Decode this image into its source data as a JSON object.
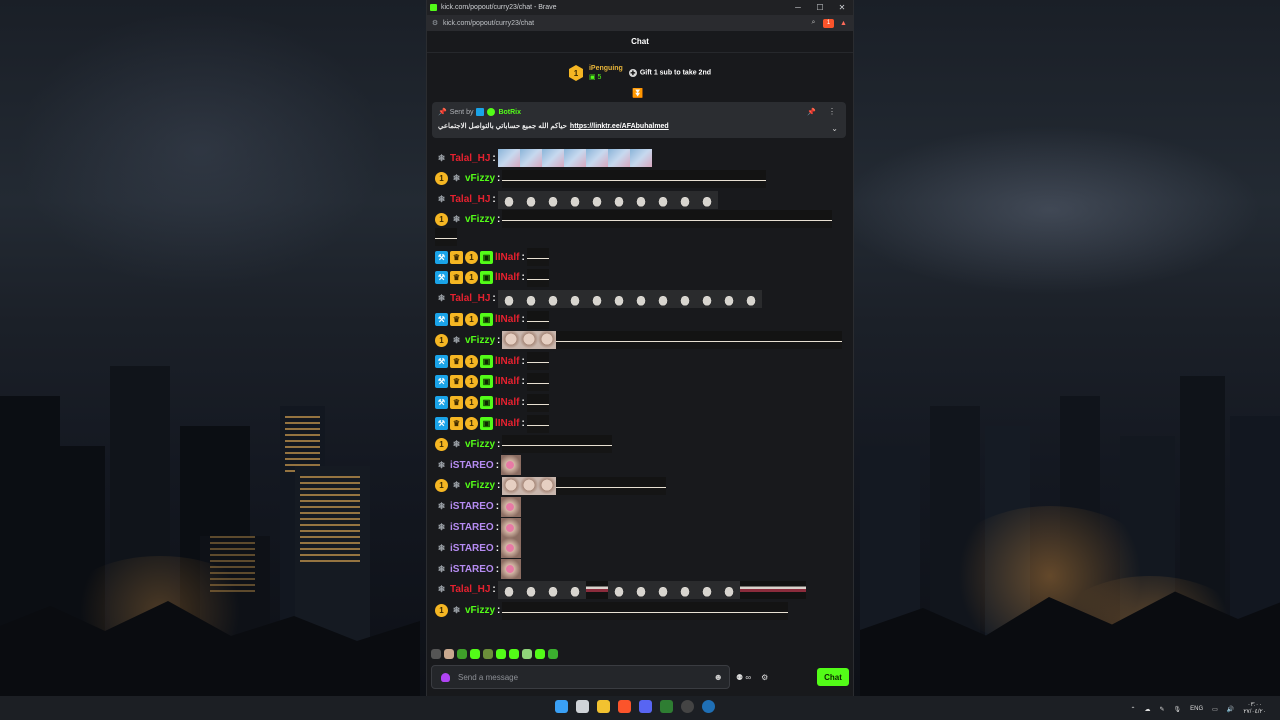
{
  "window": {
    "title": "kick.com/popout/curry23/chat - Brave",
    "url": "kick.com/popout/curry23/chat",
    "brave_badge": "1"
  },
  "chat": {
    "header": "Chat",
    "leaderboard": {
      "rank": "1",
      "user": "iPenguing",
      "count": "5",
      "gift_text": "Gift 1 sub to take 2nd"
    },
    "pinned": {
      "sent_by_label": "Sent by",
      "bot_name": "BotRix",
      "text": "حياكم الله جميع حساباتي بالتواصل الاجتماعي",
      "link": "https://linktr.ee/AFAbuhalmed"
    },
    "messages": [
      {
        "user": "Talal_HJ",
        "color": "#e6212f",
        "badges": [
          "snow"
        ],
        "emotes": [
          "blue",
          "blue",
          "blue",
          "blue",
          "blue",
          "blue",
          "blue"
        ]
      },
      {
        "user": "vFizzy",
        "color": "#53fc18",
        "badges": [
          "sub",
          "snow"
        ],
        "emotes": [
          "dark",
          "dark",
          "dark",
          "dark",
          "dark",
          "dark",
          "dark",
          "dark",
          "dark",
          "dark",
          "dark",
          "dark"
        ]
      },
      {
        "user": "Talal_HJ",
        "color": "#e6212f",
        "badges": [
          "snow"
        ],
        "emotes": [
          "puff",
          "puff",
          "puff",
          "puff",
          "puff",
          "puff",
          "puff",
          "puff",
          "puff",
          "puff"
        ]
      },
      {
        "user": "vFizzy",
        "color": "#53fc18",
        "badges": [
          "sub",
          "snow"
        ],
        "emotes": [
          "dark",
          "dark",
          "dark",
          "dark",
          "dark",
          "dark",
          "dark",
          "dark",
          "dark",
          "dark",
          "dark",
          "dark",
          "dark",
          "dark",
          "dark",
          "dark"
        ]
      },
      {
        "user": "lINalf",
        "color": "#e6212f",
        "badges": [
          "mod",
          "crown",
          "sub",
          "gift"
        ],
        "emotes": [
          "dark"
        ]
      },
      {
        "user": "lINalf",
        "color": "#e6212f",
        "badges": [
          "mod",
          "crown",
          "sub",
          "gift"
        ],
        "emotes": [
          "dark"
        ]
      },
      {
        "user": "Talal_HJ",
        "color": "#e6212f",
        "badges": [
          "snow"
        ],
        "emotes": [
          "puff",
          "puff",
          "puff",
          "puff",
          "puff",
          "puff",
          "puff",
          "puff",
          "puff",
          "puff",
          "puff",
          "puff"
        ]
      },
      {
        "user": "lINalf",
        "color": "#e6212f",
        "badges": [
          "mod",
          "crown",
          "sub",
          "gift"
        ],
        "emotes": [
          "dark"
        ]
      },
      {
        "user": "vFizzy",
        "color": "#53fc18",
        "badges": [
          "sub",
          "snow"
        ],
        "emotes": [
          "face",
          "face",
          "face",
          "dark",
          "dark",
          "dark",
          "dark",
          "dark",
          "dark",
          "dark",
          "dark",
          "dark",
          "dark",
          "dark",
          "dark",
          "dark"
        ]
      },
      {
        "user": "lINalf",
        "color": "#e6212f",
        "badges": [
          "mod",
          "crown",
          "sub",
          "gift"
        ],
        "emotes": [
          "dark"
        ]
      },
      {
        "user": "lINalf",
        "color": "#e6212f",
        "badges": [
          "mod",
          "crown",
          "sub",
          "gift"
        ],
        "emotes": [
          "dark"
        ]
      },
      {
        "user": "lINalf",
        "color": "#e6212f",
        "badges": [
          "mod",
          "crown",
          "sub",
          "gift"
        ],
        "emotes": [
          "dark"
        ]
      },
      {
        "user": "lINalf",
        "color": "#e6212f",
        "badges": [
          "mod",
          "crown",
          "sub",
          "gift"
        ],
        "emotes": [
          "dark"
        ]
      },
      {
        "user": "vFizzy",
        "color": "#53fc18",
        "badges": [
          "sub",
          "snow"
        ],
        "emotes": [
          "dark",
          "dark",
          "dark",
          "dark",
          "dark"
        ]
      },
      {
        "user": "iSTAREO",
        "color": "#b68cf2",
        "badges": [
          "snow"
        ],
        "emotes": [
          "pink"
        ]
      },
      {
        "user": "vFizzy",
        "color": "#53fc18",
        "badges": [
          "sub",
          "snow"
        ],
        "emotes": [
          "face",
          "face",
          "face",
          "dark",
          "dark",
          "dark",
          "dark",
          "dark"
        ]
      },
      {
        "user": "iSTAREO",
        "color": "#b68cf2",
        "badges": [
          "snow"
        ],
        "emotes": [
          "pink"
        ]
      },
      {
        "user": "iSTAREO",
        "color": "#b68cf2",
        "badges": [
          "snow"
        ],
        "emotes": [
          "pink"
        ]
      },
      {
        "user": "iSTAREO",
        "color": "#b68cf2",
        "badges": [
          "snow"
        ],
        "emotes": [
          "pink"
        ]
      },
      {
        "user": "iSTAREO",
        "color": "#b68cf2",
        "badges": [
          "snow"
        ],
        "emotes": [
          "pink"
        ]
      },
      {
        "user": "Talal_HJ",
        "color": "#e6212f",
        "badges": [
          "snow"
        ],
        "emotes": [
          "puff",
          "puff",
          "puff",
          "puff",
          "bar",
          "puff",
          "puff",
          "puff",
          "puff",
          "puff",
          "puff",
          "bar",
          "bar",
          "bar"
        ]
      },
      {
        "user": "vFizzy",
        "color": "#53fc18",
        "badges": [
          "sub",
          "snow"
        ],
        "emotes": [
          "dark",
          "dark",
          "dark",
          "dark",
          "dark",
          "dark",
          "dark",
          "dark",
          "dark",
          "dark",
          "dark",
          "dark",
          "dark"
        ]
      }
    ],
    "input": {
      "placeholder": "Send a message",
      "infinity": "∞",
      "send_label": "Chat"
    }
  },
  "badge_glyphs": {
    "mod": "⚒",
    "crown": "♛",
    "sub": "1",
    "gift": "▣",
    "snow": "❄"
  },
  "taskbar": {
    "lang": "ENG",
    "time": "٠٣:٠٠",
    "date": "٢٧/٠٤/٢٠"
  }
}
